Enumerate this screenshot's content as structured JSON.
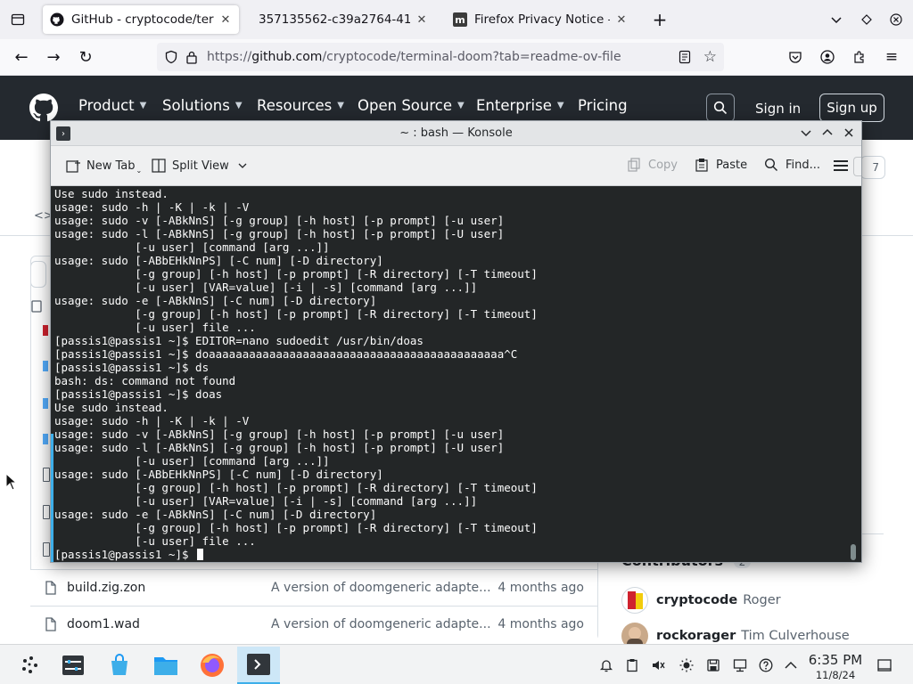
{
  "browser": {
    "tabs": [
      {
        "label": "GitHub - cryptocode/terminal-doom",
        "favicon": "github-icon",
        "active": true
      },
      {
        "label": "357135562-c39a2764-4147-46",
        "favicon": "none",
        "active": false
      },
      {
        "label": "Firefox Privacy Notice — Mozilla",
        "favicon": "mozilla-icon",
        "active": false
      }
    ],
    "url": {
      "prefix": "https://",
      "host": "github.com",
      "path": "/cryptocode/terminal-doom?tab=readme-ov-file"
    }
  },
  "github": {
    "nav": [
      "Product",
      "Solutions",
      "Resources",
      "Open Source",
      "Enterprise",
      "Pricing"
    ],
    "sign_in": "Sign in",
    "sign_up": "Sign up",
    "files": [
      {
        "name": "build.zig.zon",
        "message": "A version of doomgeneric adapte...",
        "date": "4 months ago"
      },
      {
        "name": "doom1.wad",
        "message": "A version of doomgeneric adapte...",
        "date": "4 months ago"
      }
    ],
    "contributors_heading": "Contributors",
    "contributors_count": "2",
    "contributors": [
      {
        "login": "cryptocode",
        "name": "Roger"
      },
      {
        "login": "rockorager",
        "name": "Tim Culverhouse"
      }
    ],
    "partial_count": "7"
  },
  "konsole": {
    "title": "~ : bash — Konsole",
    "toolbar": {
      "new_tab": "New Tab",
      "split_view": "Split View",
      "copy": "Copy",
      "paste": "Paste",
      "find": "Find..."
    },
    "lines": [
      "Use sudo instead.",
      "usage: sudo -h | -K | -k | -V",
      "usage: sudo -v [-ABkNnS] [-g group] [-h host] [-p prompt] [-u user]",
      "usage: sudo -l [-ABkNnS] [-g group] [-h host] [-p prompt] [-U user]",
      "            [-u user] [command [arg ...]]",
      "usage: sudo [-ABbEHkNnPS] [-C num] [-D directory]",
      "            [-g group] [-h host] [-p prompt] [-R directory] [-T timeout]",
      "            [-u user] [VAR=value] [-i | -s] [command [arg ...]]",
      "usage: sudo -e [-ABkNnS] [-C num] [-D directory]",
      "            [-g group] [-h host] [-p prompt] [-R directory] [-T timeout]",
      "            [-u user] file ...",
      "[passis1@passis1 ~]$ EDITOR=nano sudoedit /usr/bin/doas",
      "[passis1@passis1 ~]$ doaaaaaaaaaaaaaaaaaaaaaaaaaaaaaaaaaaaaaaaaaaaa^C",
      "[passis1@passis1 ~]$ ds",
      "bash: ds: command not found",
      "[passis1@passis1 ~]$ doas",
      "Use sudo instead.",
      "usage: sudo -h | -K | -k | -V",
      "usage: sudo -v [-ABkNnS] [-g group] [-h host] [-p prompt] [-u user]",
      "usage: sudo -l [-ABkNnS] [-g group] [-h host] [-p prompt] [-U user]",
      "            [-u user] [command [arg ...]]",
      "usage: sudo [-ABbEHkNnPS] [-C num] [-D directory]",
      "            [-g group] [-h host] [-p prompt] [-R directory] [-T timeout]",
      "            [-u user] [VAR=value] [-i | -s] [command [arg ...]]",
      "usage: sudo -e [-ABkNnS] [-C num] [-D directory]",
      "            [-g group] [-h host] [-p prompt] [-R directory] [-T timeout]",
      "            [-u user] file ..."
    ],
    "prompt": "[passis1@passis1 ~]$ "
  },
  "panel": {
    "time": "6:35 PM",
    "date": "11/8/24"
  }
}
